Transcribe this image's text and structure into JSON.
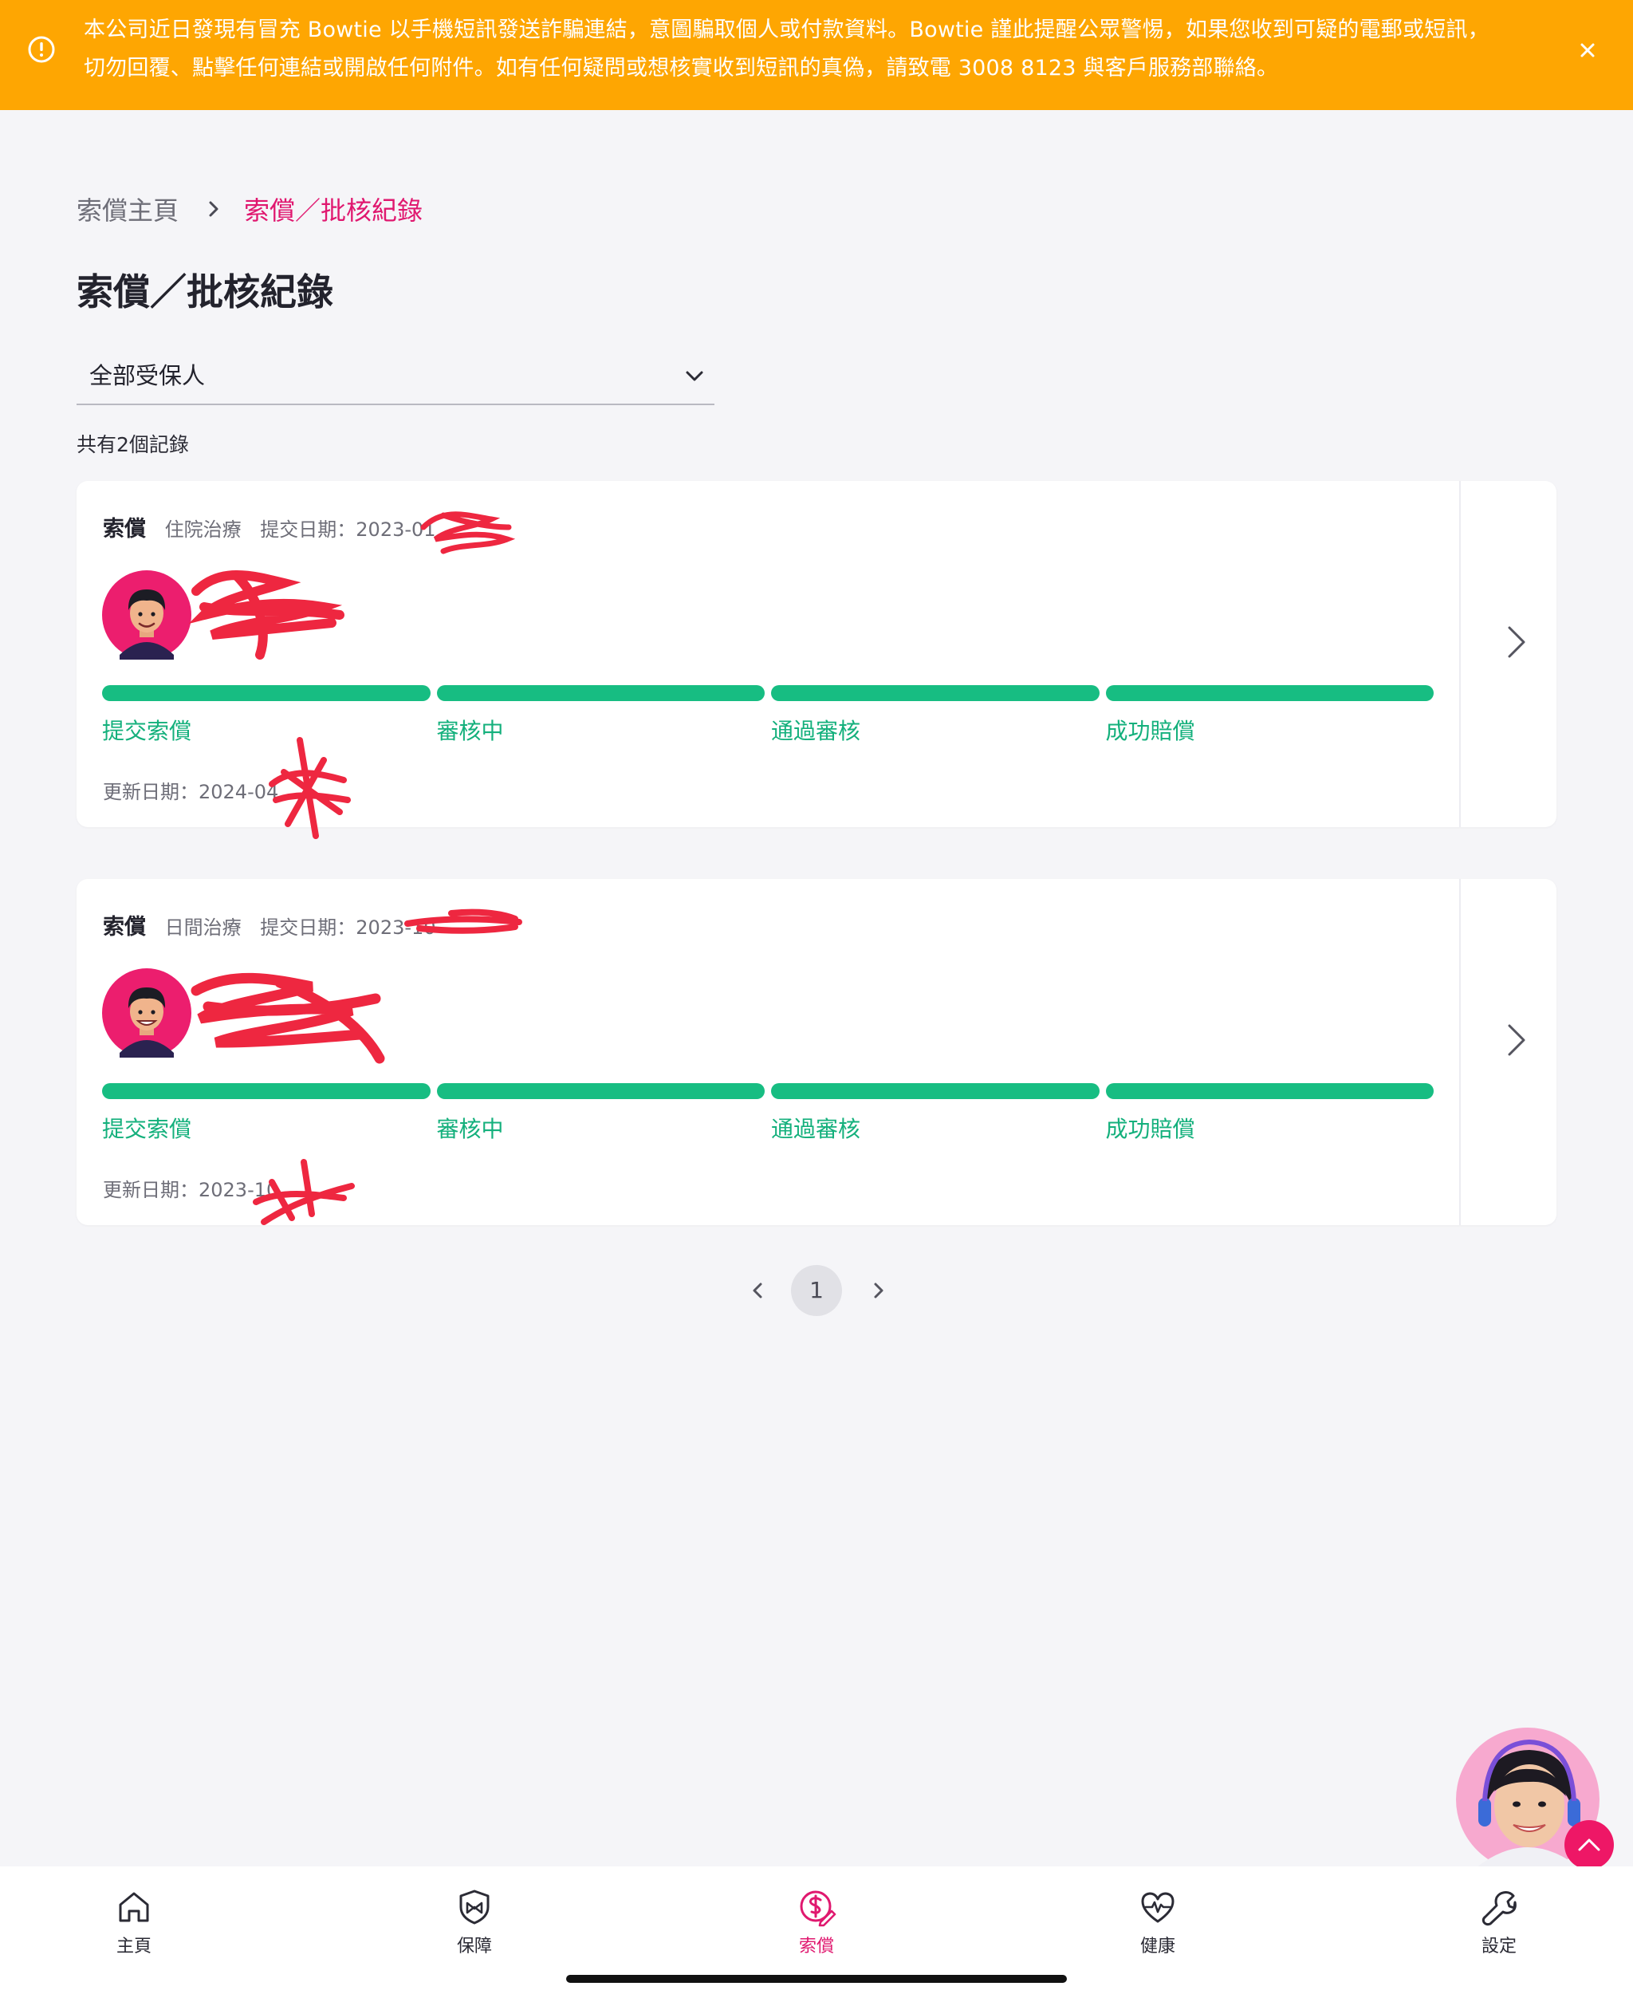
{
  "banner": {
    "line1": "本公司近日發現有冒充 Bowtie 以手機短訊發送詐騙連結，意圖騙取個人或付款資料。Bowtie 謹此提醒公眾警惕，如果您收到可疑的電郵或短訊，",
    "line2": "切勿回覆、點擊任何連結或開啟任何附件。如有任何疑問或想核實收到短訊的真偽，請致電 3008 8123 與客戶服務部聯絡。",
    "icon": "alert-circle-icon",
    "close_icon": "close-icon",
    "color": "#fea602"
  },
  "breadcrumb": {
    "home": "索償主頁",
    "current": "索償／批核紀錄"
  },
  "page_title": "索償／批核紀錄",
  "filter": {
    "selected": "全部受保人"
  },
  "record_count": "共有2個記錄",
  "claims": [
    {
      "type": "索償",
      "category": "住院治療",
      "submitted": "提交日期：2023-01",
      "updated": "更新日期：2024-04",
      "steps": [
        "提交索償",
        "審核中",
        "通過審核",
        "成功賠償"
      ],
      "completed_steps": 4
    },
    {
      "type": "索償",
      "category": "日間治療",
      "submitted": "提交日期：2023-10",
      "updated": "更新日期：2023-10",
      "steps": [
        "提交索償",
        "審核中",
        "通過審核",
        "成功賠償"
      ],
      "completed_steps": 4
    }
  ],
  "pagination": {
    "current_page": "1"
  },
  "bottom_nav": {
    "items": [
      {
        "label": "主頁",
        "icon": "home-icon"
      },
      {
        "label": "保障",
        "icon": "shield-icon"
      },
      {
        "label": "索償",
        "icon": "dollar-claim-icon",
        "active": true
      },
      {
        "label": "健康",
        "icon": "heart-pulse-icon"
      },
      {
        "label": "設定",
        "icon": "wrench-icon"
      }
    ]
  },
  "colors": {
    "accent": "#e0186f",
    "progress": "#17bd82",
    "step_text": "#14b07c",
    "background": "#f5f5f8"
  }
}
